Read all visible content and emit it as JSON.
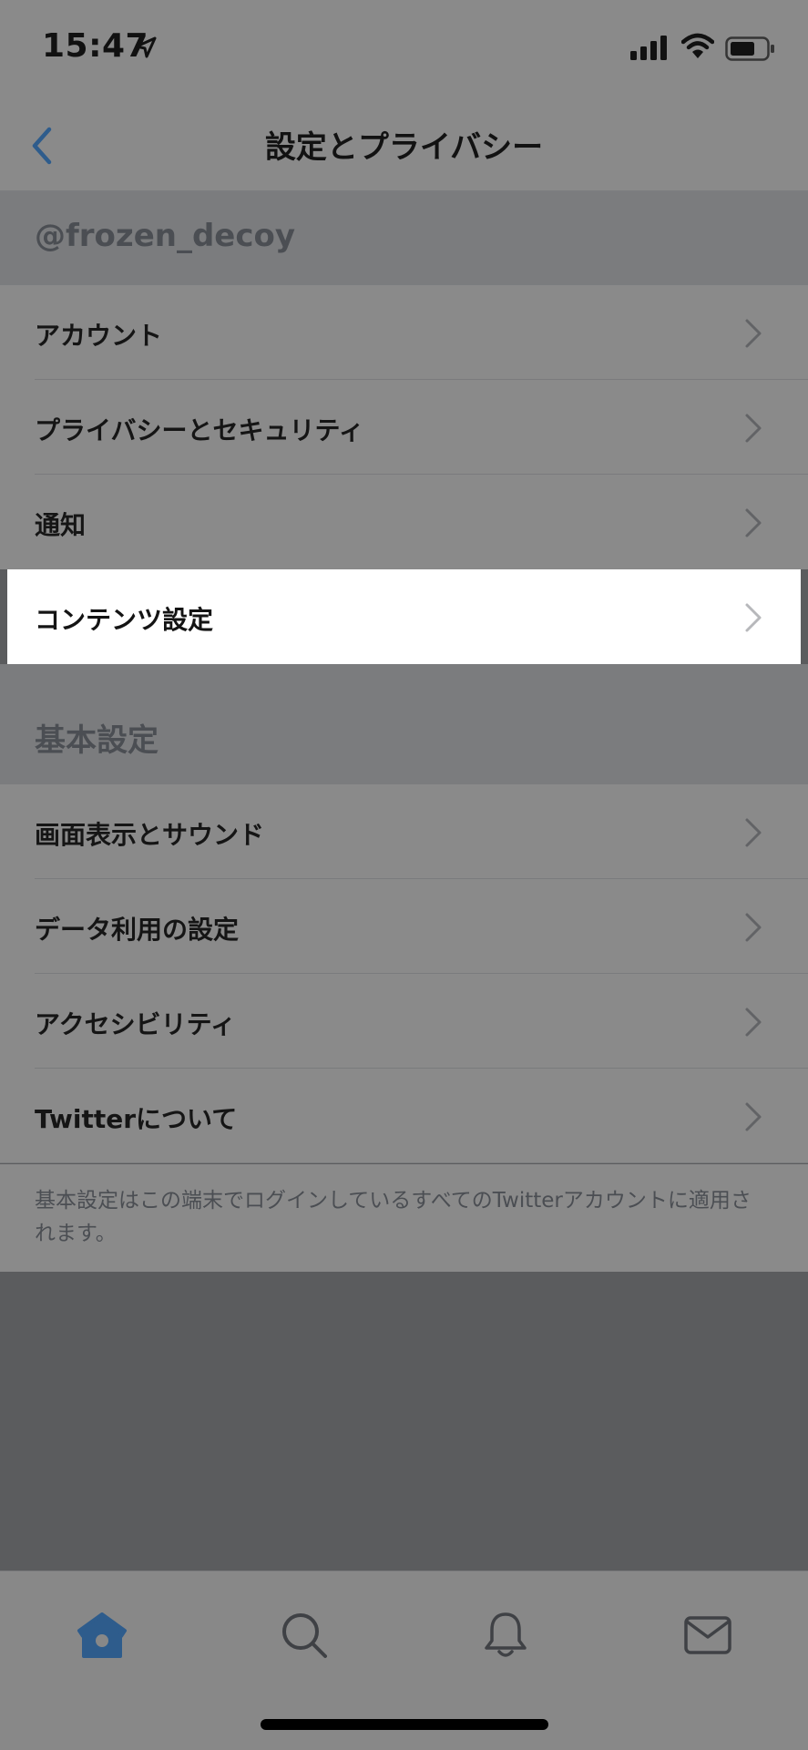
{
  "status_bar": {
    "time": "15:47"
  },
  "nav": {
    "title": "設定とプライバシー"
  },
  "account_section": {
    "header": "@frozen_decoy",
    "items": [
      {
        "label": "アカウント"
      },
      {
        "label": "プライバシーとセキュリティ"
      },
      {
        "label": "通知"
      },
      {
        "label": "コンテンツ設定"
      }
    ]
  },
  "general_section": {
    "header": "基本設定",
    "items": [
      {
        "label": "画面表示とサウンド"
      },
      {
        "label": "データ利用の設定"
      },
      {
        "label": "アクセシビリティ"
      },
      {
        "label": "Twitterについて"
      }
    ],
    "footnote": "基本設定はこの端末でログインしているすべてのTwitterアカウントに適用されます。"
  },
  "tab_bar": {
    "tabs": [
      {
        "icon": "home-icon",
        "selected": true
      },
      {
        "icon": "search-icon",
        "selected": false
      },
      {
        "icon": "notifications-bell-icon",
        "selected": false
      },
      {
        "icon": "messages-envelope-icon",
        "selected": false
      }
    ]
  },
  "colors": {
    "accent": "#2e5c8c",
    "dim_overlay_bg": "#8a8a8a",
    "highlight_row_bg": "#ffffff"
  }
}
